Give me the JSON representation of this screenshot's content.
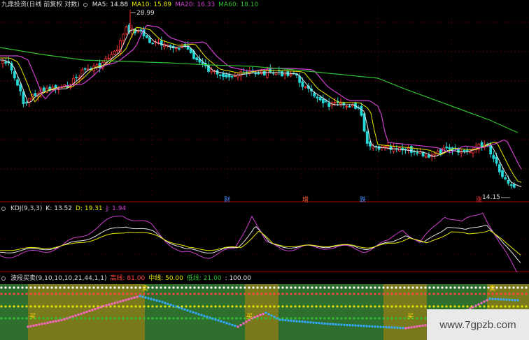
{
  "main_legend": {
    "title": "九鼎投资(日线 前复权 对数)",
    "ma5_label": "MA5:",
    "ma5": "14.88",
    "ma10_label": "MA10:",
    "ma10": "15.89",
    "ma20_label": "MA20:",
    "ma20": "16.33",
    "ma60_label": "MA60:",
    "ma60": "18.10"
  },
  "main_annotations": {
    "high": "28.99",
    "low": "14.15",
    "event_labels": [
      "财",
      "增",
      "跌",
      "涨"
    ]
  },
  "kdj_legend": {
    "title": "KDJ(9,3,3)",
    "k_label": "K:",
    "k": "13.52",
    "d_label": "D:",
    "d": "19.31",
    "j_label": "J:",
    "j": "1.94"
  },
  "wave_legend": {
    "title": "波段买卖(9,10,10,10,21,44,1,1)",
    "high_label": "高线:",
    "high": "81.00",
    "mid_label": "中线:",
    "mid": "50.00",
    "low_label": "低线:",
    "low": "21.00",
    "top_value": ": 100.00"
  },
  "wave_signals": {
    "buy": "买",
    "sell": "卖"
  },
  "watermark": "www.7gpzb.com",
  "colors": {
    "up": "#ff3333",
    "down": "#27d6d6",
    "ma5": "#e8e8e8",
    "ma10": "#e8e800",
    "ma20": "#d040d0",
    "ma60": "#30c030",
    "k": "#e8e8e8",
    "d": "#e8e800",
    "j": "#d040d0"
  }
}
